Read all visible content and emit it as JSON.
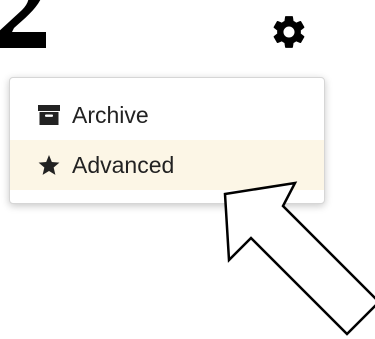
{
  "toolbar": {
    "settings_icon": "gear-icon",
    "cropped_glyph": "2"
  },
  "menu": {
    "items": [
      {
        "label": "Archive",
        "icon": "archive-icon",
        "hovered": false
      },
      {
        "label": "Advanced",
        "icon": "star-icon",
        "hovered": true
      }
    ]
  },
  "colors": {
    "hover_background": "#fcf6e6",
    "text": "#222222",
    "icon": "#222222"
  }
}
